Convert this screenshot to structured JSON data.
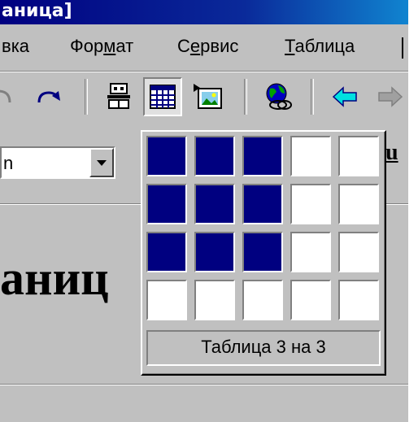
{
  "window": {
    "title": "аница]"
  },
  "menu": {
    "items": [
      {
        "pre": "вка",
        "ul": "",
        "post": ""
      },
      {
        "pre": "Фор",
        "ul": "м",
        "post": "ат"
      },
      {
        "pre": "С",
        "ul": "е",
        "post": "рвис"
      },
      {
        "pre": "",
        "ul": "Т",
        "post": "аблица"
      }
    ]
  },
  "toolbar": {
    "icons": [
      "undo-icon",
      "redo-icon",
      "tables-borders-icon",
      "insert-table-icon",
      "insert-picture-icon",
      "web-icon",
      "back-icon",
      "forward-icon"
    ]
  },
  "format_bar": {
    "font_value": "n",
    "underline_label": "u"
  },
  "document": {
    "text": "аниц"
  },
  "table_picker": {
    "rows": 4,
    "cols": 5,
    "selected_rows": 3,
    "selected_cols": 3,
    "selected_color": "#000080",
    "label": "Таблица 3 на 3"
  }
}
